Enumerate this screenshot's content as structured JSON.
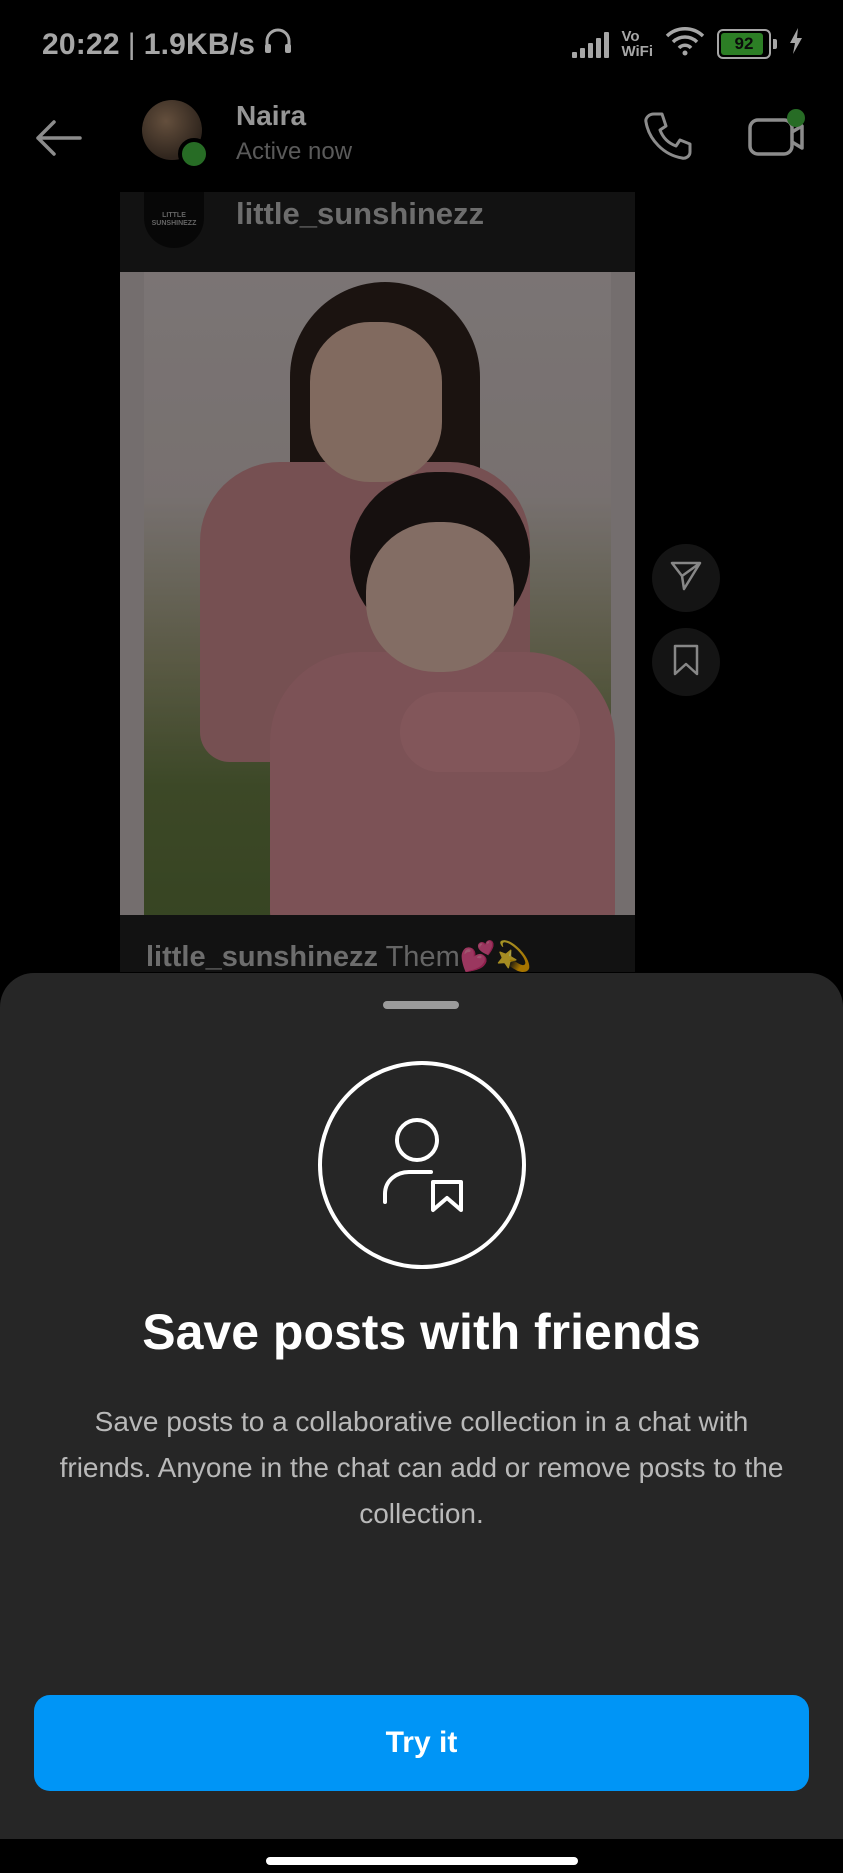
{
  "status_bar": {
    "time": "20:22",
    "separator": "|",
    "network_speed": "1.9KB/s",
    "vowifi_top": "Vo",
    "vowifi_bottom": "WiFi",
    "battery_level": "92",
    "battery_fraction": 0.92
  },
  "chat_header": {
    "contact_name": "Naira",
    "contact_status": "Active now",
    "icons": {
      "back": "back-arrow-icon",
      "call": "phone-icon",
      "video": "video-camera-icon"
    },
    "online_color": "#3ca63a"
  },
  "post": {
    "username": "little_sunshinezz",
    "avatar_text": "LITTLE SUNSHINEZZ",
    "caption_user": "little_sunshinezz",
    "caption_text": "Them💕💫"
  },
  "side_actions": {
    "share_icon": "paper-plane-icon",
    "save_icon": "bookmark-icon"
  },
  "sheet": {
    "icon": "person-bookmark-icon",
    "title": "Save posts with friends",
    "description": "Save posts to a collaborative collection in a chat with friends. Anyone in the chat can add or remove posts to the collection.",
    "button_label": "Try it",
    "button_color": "#0095f6"
  }
}
